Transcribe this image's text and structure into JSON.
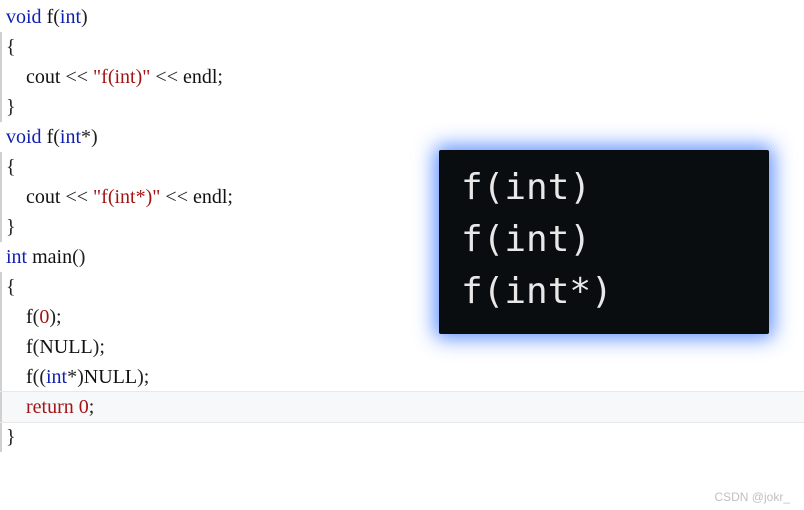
{
  "code": {
    "lines": [
      {
        "tokens": [
          {
            "t": "void",
            "c": "k-type"
          },
          {
            "t": " "
          },
          {
            "t": "f",
            "c": "ident"
          },
          {
            "t": "(",
            "c": "punct"
          },
          {
            "t": "int",
            "c": "k-type"
          },
          {
            "t": ")",
            "c": "punct"
          }
        ]
      },
      {
        "tokens": [
          {
            "t": "{",
            "c": "punct"
          }
        ],
        "guide": true
      },
      {
        "tokens": [
          {
            "t": "    "
          },
          {
            "t": "cout",
            "c": "ident"
          },
          {
            "t": " << ",
            "c": "op"
          },
          {
            "t": "\"f(int)\"",
            "c": "str"
          },
          {
            "t": " << ",
            "c": "op"
          },
          {
            "t": "endl",
            "c": "ident"
          },
          {
            "t": ";",
            "c": "punct"
          }
        ],
        "guide": true
      },
      {
        "tokens": [
          {
            "t": "}",
            "c": "punct"
          }
        ],
        "guide": true
      },
      {
        "tokens": [
          {
            "t": "void",
            "c": "k-type"
          },
          {
            "t": " "
          },
          {
            "t": "f",
            "c": "ident"
          },
          {
            "t": "(",
            "c": "punct"
          },
          {
            "t": "int",
            "c": "k-type"
          },
          {
            "t": "*",
            "c": "punct"
          },
          {
            "t": ")",
            "c": "punct"
          }
        ]
      },
      {
        "tokens": [
          {
            "t": "{",
            "c": "punct"
          }
        ],
        "guide": true
      },
      {
        "tokens": [
          {
            "t": "    "
          },
          {
            "t": "cout",
            "c": "ident"
          },
          {
            "t": " << ",
            "c": "op"
          },
          {
            "t": "\"f(int*)\"",
            "c": "str"
          },
          {
            "t": " << ",
            "c": "op"
          },
          {
            "t": "endl",
            "c": "ident"
          },
          {
            "t": ";",
            "c": "punct"
          }
        ],
        "guide": true
      },
      {
        "tokens": [
          {
            "t": "}",
            "c": "punct"
          }
        ],
        "guide": true
      },
      {
        "tokens": [
          {
            "t": "int",
            "c": "k-type"
          },
          {
            "t": " "
          },
          {
            "t": "main",
            "c": "ident"
          },
          {
            "t": "()",
            "c": "punct"
          }
        ]
      },
      {
        "tokens": [
          {
            "t": "{",
            "c": "punct"
          }
        ],
        "guide": true
      },
      {
        "tokens": [
          {
            "t": "    "
          },
          {
            "t": "f",
            "c": "ident"
          },
          {
            "t": "(",
            "c": "punct"
          },
          {
            "t": "0",
            "c": "num"
          },
          {
            "t": ");",
            "c": "punct"
          }
        ],
        "guide": true
      },
      {
        "tokens": [
          {
            "t": "    "
          },
          {
            "t": "f",
            "c": "ident"
          },
          {
            "t": "(",
            "c": "punct"
          },
          {
            "t": "NULL",
            "c": "null"
          },
          {
            "t": ");",
            "c": "punct"
          }
        ],
        "guide": true
      },
      {
        "tokens": [
          {
            "t": "    "
          },
          {
            "t": "f",
            "c": "ident"
          },
          {
            "t": "((",
            "c": "punct"
          },
          {
            "t": "int",
            "c": "k-type"
          },
          {
            "t": "*)",
            "c": "punct"
          },
          {
            "t": "NULL",
            "c": "null"
          },
          {
            "t": ");",
            "c": "punct"
          }
        ],
        "guide": true
      },
      {
        "tokens": [
          {
            "t": "    "
          },
          {
            "t": "return",
            "c": "k-return"
          },
          {
            "t": " "
          },
          {
            "t": "0",
            "c": "num"
          },
          {
            "t": ";",
            "c": "punct"
          }
        ],
        "guide": true,
        "active": true
      },
      {
        "tokens": [
          {
            "t": "}",
            "c": "punct"
          }
        ],
        "guide": true
      }
    ]
  },
  "output": {
    "lines": [
      "f(int)",
      "f(int)",
      "f(int*)"
    ]
  },
  "watermark": "CSDN @jokr_"
}
